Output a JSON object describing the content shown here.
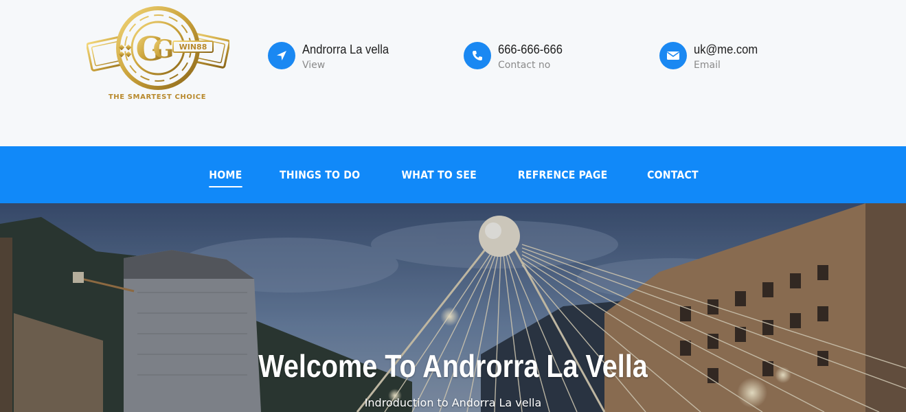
{
  "brand": {
    "logo_text": "GGWIN88",
    "tagline": "THE SMARTEST CHOICE"
  },
  "contacts": [
    {
      "icon": "location-arrow-icon",
      "title": "Androrra La vella",
      "subtitle": "View"
    },
    {
      "icon": "phone-icon",
      "title": "666-666-666",
      "subtitle": "Contact no"
    },
    {
      "icon": "envelope-icon",
      "title": "uk@me.com",
      "subtitle": "Email"
    }
  ],
  "nav": {
    "items": [
      "HOME",
      "THINGS TO DO",
      "WHAT TO SEE",
      "REFRENCE PAGE",
      "CONTACT"
    ],
    "active": "HOME"
  },
  "hero": {
    "title": "Welcome To Androrra La Vella",
    "subtitle": "Indroduction to Andorra La vella"
  },
  "colors": {
    "accent": "#1189f9",
    "icon_bg": "#1a88f2",
    "header_bg": "#f6f8fa",
    "logo_gold": "#c9a13a"
  }
}
